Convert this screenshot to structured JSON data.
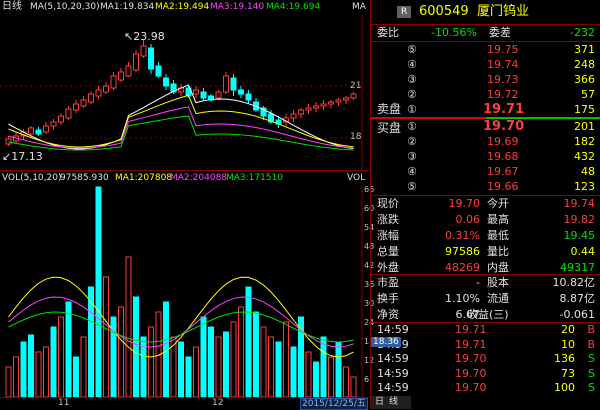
{
  "chart_title": "日线",
  "ma_legend": {
    "label": "MA(5,10,20,30)",
    "ma1": "MA1:19.834",
    "ma2": "MA2:19.494",
    "ma3": "MA3:19.140",
    "ma4": "MA4:19.694",
    "right_flag": "MA"
  },
  "price_chart": {
    "high_label": "23.98",
    "low_label": "17.13",
    "axis_21": "21",
    "axis_18": "18"
  },
  "vol_legend": {
    "label": "VOL(5,10,20)",
    "vol": "97585.930",
    "ma1": "MA1:207808",
    "ma2": "MA2:204088",
    "ma3": "MA3:171510",
    "right_flag": "VOL"
  },
  "vol_axis": [
    "66",
    "60",
    "54",
    "48",
    "42",
    "36",
    "30",
    "24",
    "18",
    "12",
    "6"
  ],
  "vol_unit": "x万",
  "vol_current_badge": "18.36",
  "x_labels": {
    "m11": "11",
    "m12": "12"
  },
  "date_badge": "2015/12/25/五",
  "bottom_tabs": [
    "日",
    "线"
  ],
  "stock": {
    "badge": "R",
    "code": "600549",
    "name": "厦门钨业"
  },
  "weibi": {
    "label1": "委比",
    "value1": "-10.56%",
    "label2": "委差",
    "value2": "-232"
  },
  "sell_orders": [
    {
      "label": "⑤",
      "price": "19.75",
      "vol": "371"
    },
    {
      "label": "④",
      "price": "19.74",
      "vol": "248"
    },
    {
      "label": "③",
      "price": "19.73",
      "vol": "366"
    },
    {
      "label": "②",
      "price": "19.72",
      "vol": "57"
    },
    {
      "label": "①",
      "price": "19.71",
      "vol": "175"
    }
  ],
  "sell_title": "卖盘",
  "buy_title": "买盘",
  "buy_orders": [
    {
      "label": "①",
      "price": "19.70",
      "vol": "201"
    },
    {
      "label": "②",
      "price": "19.69",
      "vol": "182"
    },
    {
      "label": "③",
      "price": "19.68",
      "vol": "432"
    },
    {
      "label": "④",
      "price": "19.67",
      "vol": "48"
    },
    {
      "label": "⑤",
      "price": "19.66",
      "vol": "123"
    }
  ],
  "quote": [
    {
      "l1": "现价",
      "v1": "19.70",
      "l2": "今开",
      "v2": "19.74"
    },
    {
      "l1": "涨跌",
      "v1": "0.06",
      "l2": "最高",
      "v2": "19.82"
    },
    {
      "l1": "涨幅",
      "v1": "0.31%",
      "l2": "最低",
      "v2": "19.45"
    },
    {
      "l1": "总量",
      "v1": "97586",
      "l2": "量比",
      "v2": "0.44"
    },
    {
      "l1": "外盘",
      "v1": "48269",
      "l2": "内盘",
      "v2": "49317"
    }
  ],
  "fund": [
    {
      "l1": "市盈",
      "v1": "-",
      "l2": "股本",
      "v2": "10.82亿"
    },
    {
      "l1": "换手",
      "v1": "1.10%",
      "l2": "流通",
      "v2": "8.87亿"
    },
    {
      "l1": "净资",
      "v1": "6.67",
      "l2": "收益(三)",
      "v2": "-0.061"
    }
  ],
  "ticks": [
    {
      "time": "14:59",
      "price": "19.71",
      "vol": "20",
      "dir": "B"
    },
    {
      "time": "14:59",
      "price": "19.71",
      "vol": "10",
      "dir": "B"
    },
    {
      "time": "14:59",
      "price": "19.70",
      "vol": "136",
      "dir": "S"
    },
    {
      "time": "14:59",
      "price": "19.70",
      "vol": "73",
      "dir": "S"
    },
    {
      "time": "14:59",
      "price": "19.70",
      "vol": "100",
      "dir": "S"
    }
  ]
}
